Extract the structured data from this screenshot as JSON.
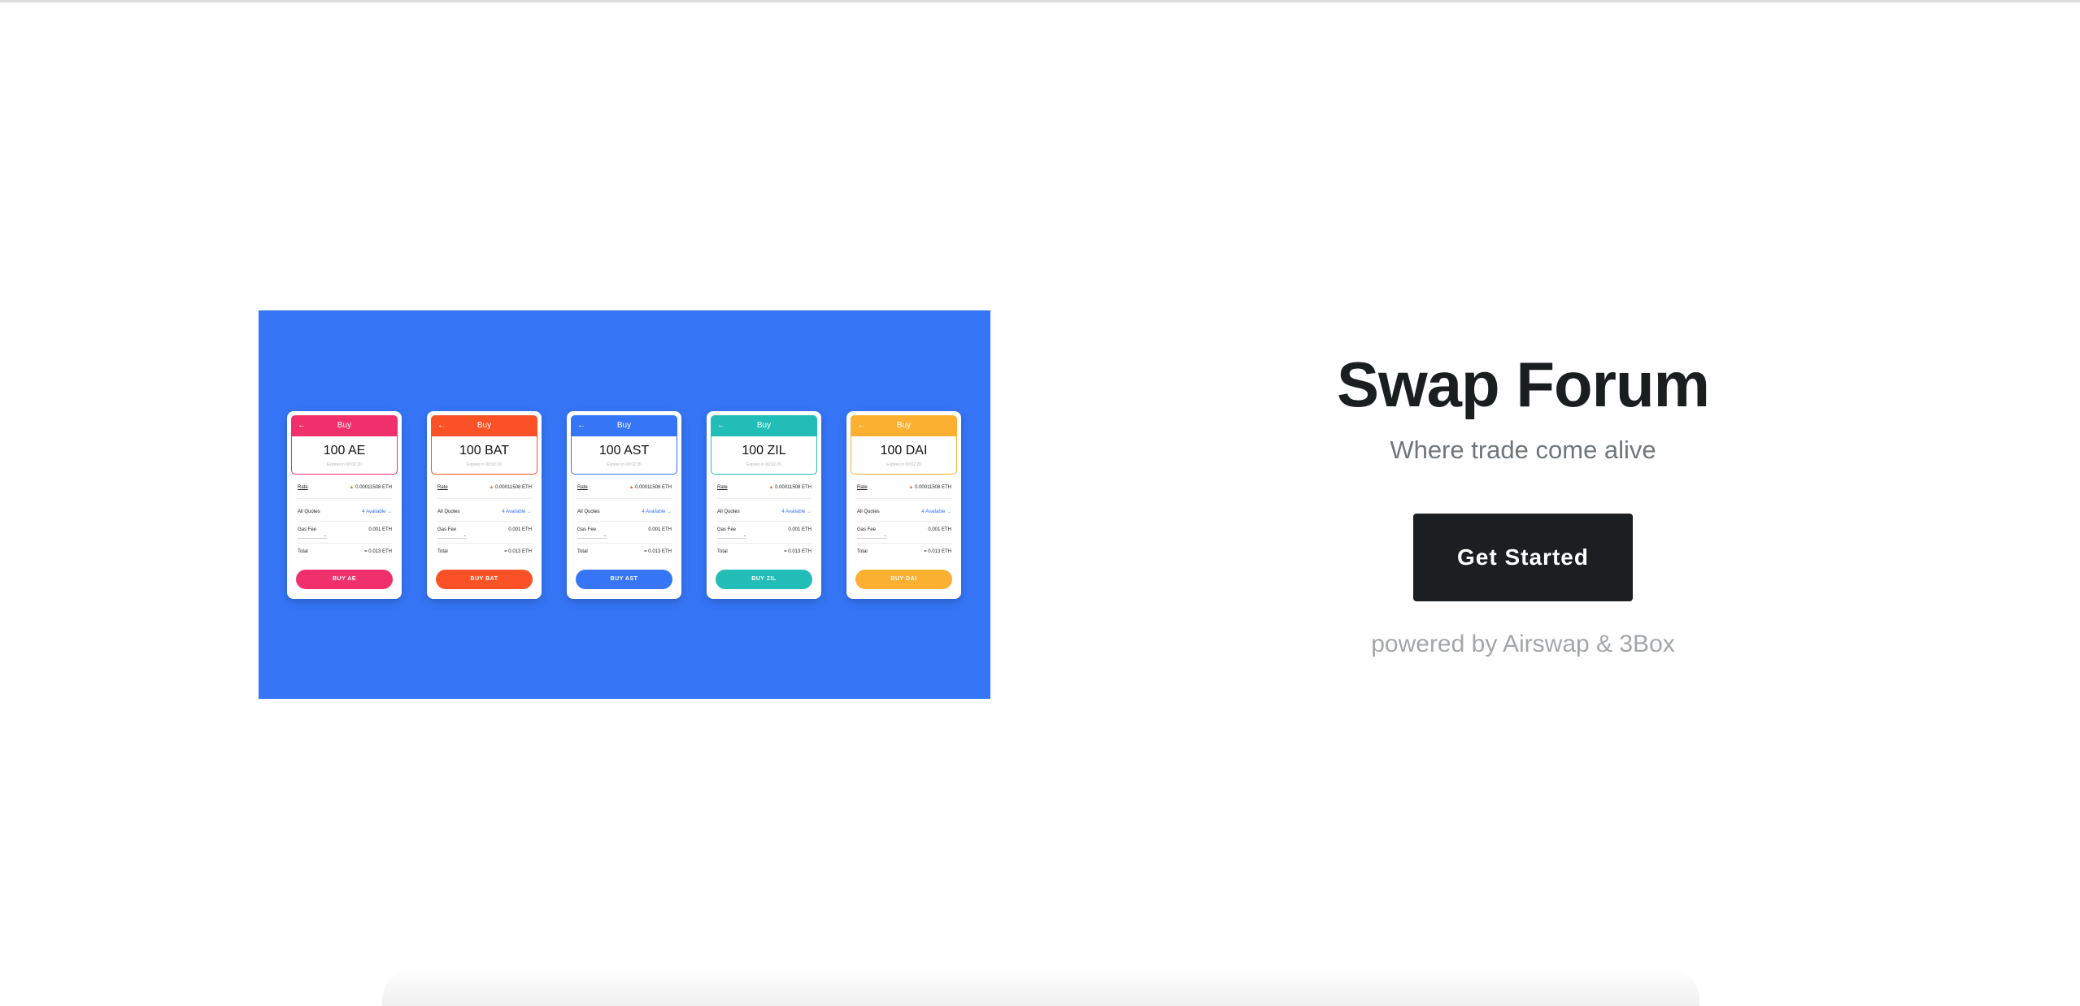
{
  "hero": {
    "cards": [
      {
        "header": "Buy",
        "amount": "100 AE",
        "expires": "Expires in 00:02:20",
        "rate_label": "Rate",
        "rate_value": "0.00011508 ETH",
        "quotes_label": "All Quotes",
        "quotes_value": "4 Available",
        "gas_label": "Gas Fee",
        "gas_value": "0.001 ETH",
        "total_label": "Total",
        "total_value": "= 0.013 ETH",
        "button": "BUY AE",
        "color": "#f0306c"
      },
      {
        "header": "Buy",
        "amount": "100 BAT",
        "expires": "Expires in 00:02:20",
        "rate_label": "Rate",
        "rate_value": "0.00011508 ETH",
        "quotes_label": "All Quotes",
        "quotes_value": "4 Available",
        "gas_label": "Gas Fee",
        "gas_value": "0.001 ETH",
        "total_label": "Total",
        "total_value": "= 0.013 ETH",
        "button": "BUY BAT",
        "color": "#fb5126"
      },
      {
        "header": "Buy",
        "amount": "100 AST",
        "expires": "Expires in 00:02:20",
        "rate_label": "Rate",
        "rate_value": "0.00011508 ETH",
        "quotes_label": "All Quotes",
        "quotes_value": "4 Available",
        "gas_label": "Gas Fee",
        "gas_value": "0.001 ETH",
        "total_label": "Total",
        "total_value": "= 0.013 ETH",
        "button": "BUY AST",
        "color": "#3575f6"
      },
      {
        "header": "Buy",
        "amount": "100 ZIL",
        "expires": "Expires in 00:02:20",
        "rate_label": "Rate",
        "rate_value": "0.00011508 ETH",
        "quotes_label": "All Quotes",
        "quotes_value": "4 Available",
        "gas_label": "Gas Fee",
        "gas_value": "0.001 ETH",
        "total_label": "Total",
        "total_value": "= 0.013 ETH",
        "button": "BUY ZIL",
        "color": "#22bdb6"
      },
      {
        "header": "Buy",
        "amount": "100 DAI",
        "expires": "Expires in 00:02:20",
        "rate_label": "Rate",
        "rate_value": "0.00011508 ETH",
        "quotes_label": "All Quotes",
        "quotes_value": "4 Available",
        "gas_label": "Gas Fee",
        "gas_value": "0.001 ETH",
        "total_label": "Total",
        "total_value": "= 0.013 ETH",
        "button": "BUY DAI",
        "color": "#fbb032"
      }
    ],
    "background_color": "#3575f6"
  },
  "main": {
    "title": "Swap Forum",
    "subtitle": "Where trade come alive",
    "cta_label": "Get Started",
    "powered_by": "powered by Airswap & 3Box"
  },
  "icons": {
    "back": "arrow-left-icon",
    "fire": "fire-icon",
    "forward": "arrow-right-icon",
    "dropdown": "chevron-down-icon"
  }
}
